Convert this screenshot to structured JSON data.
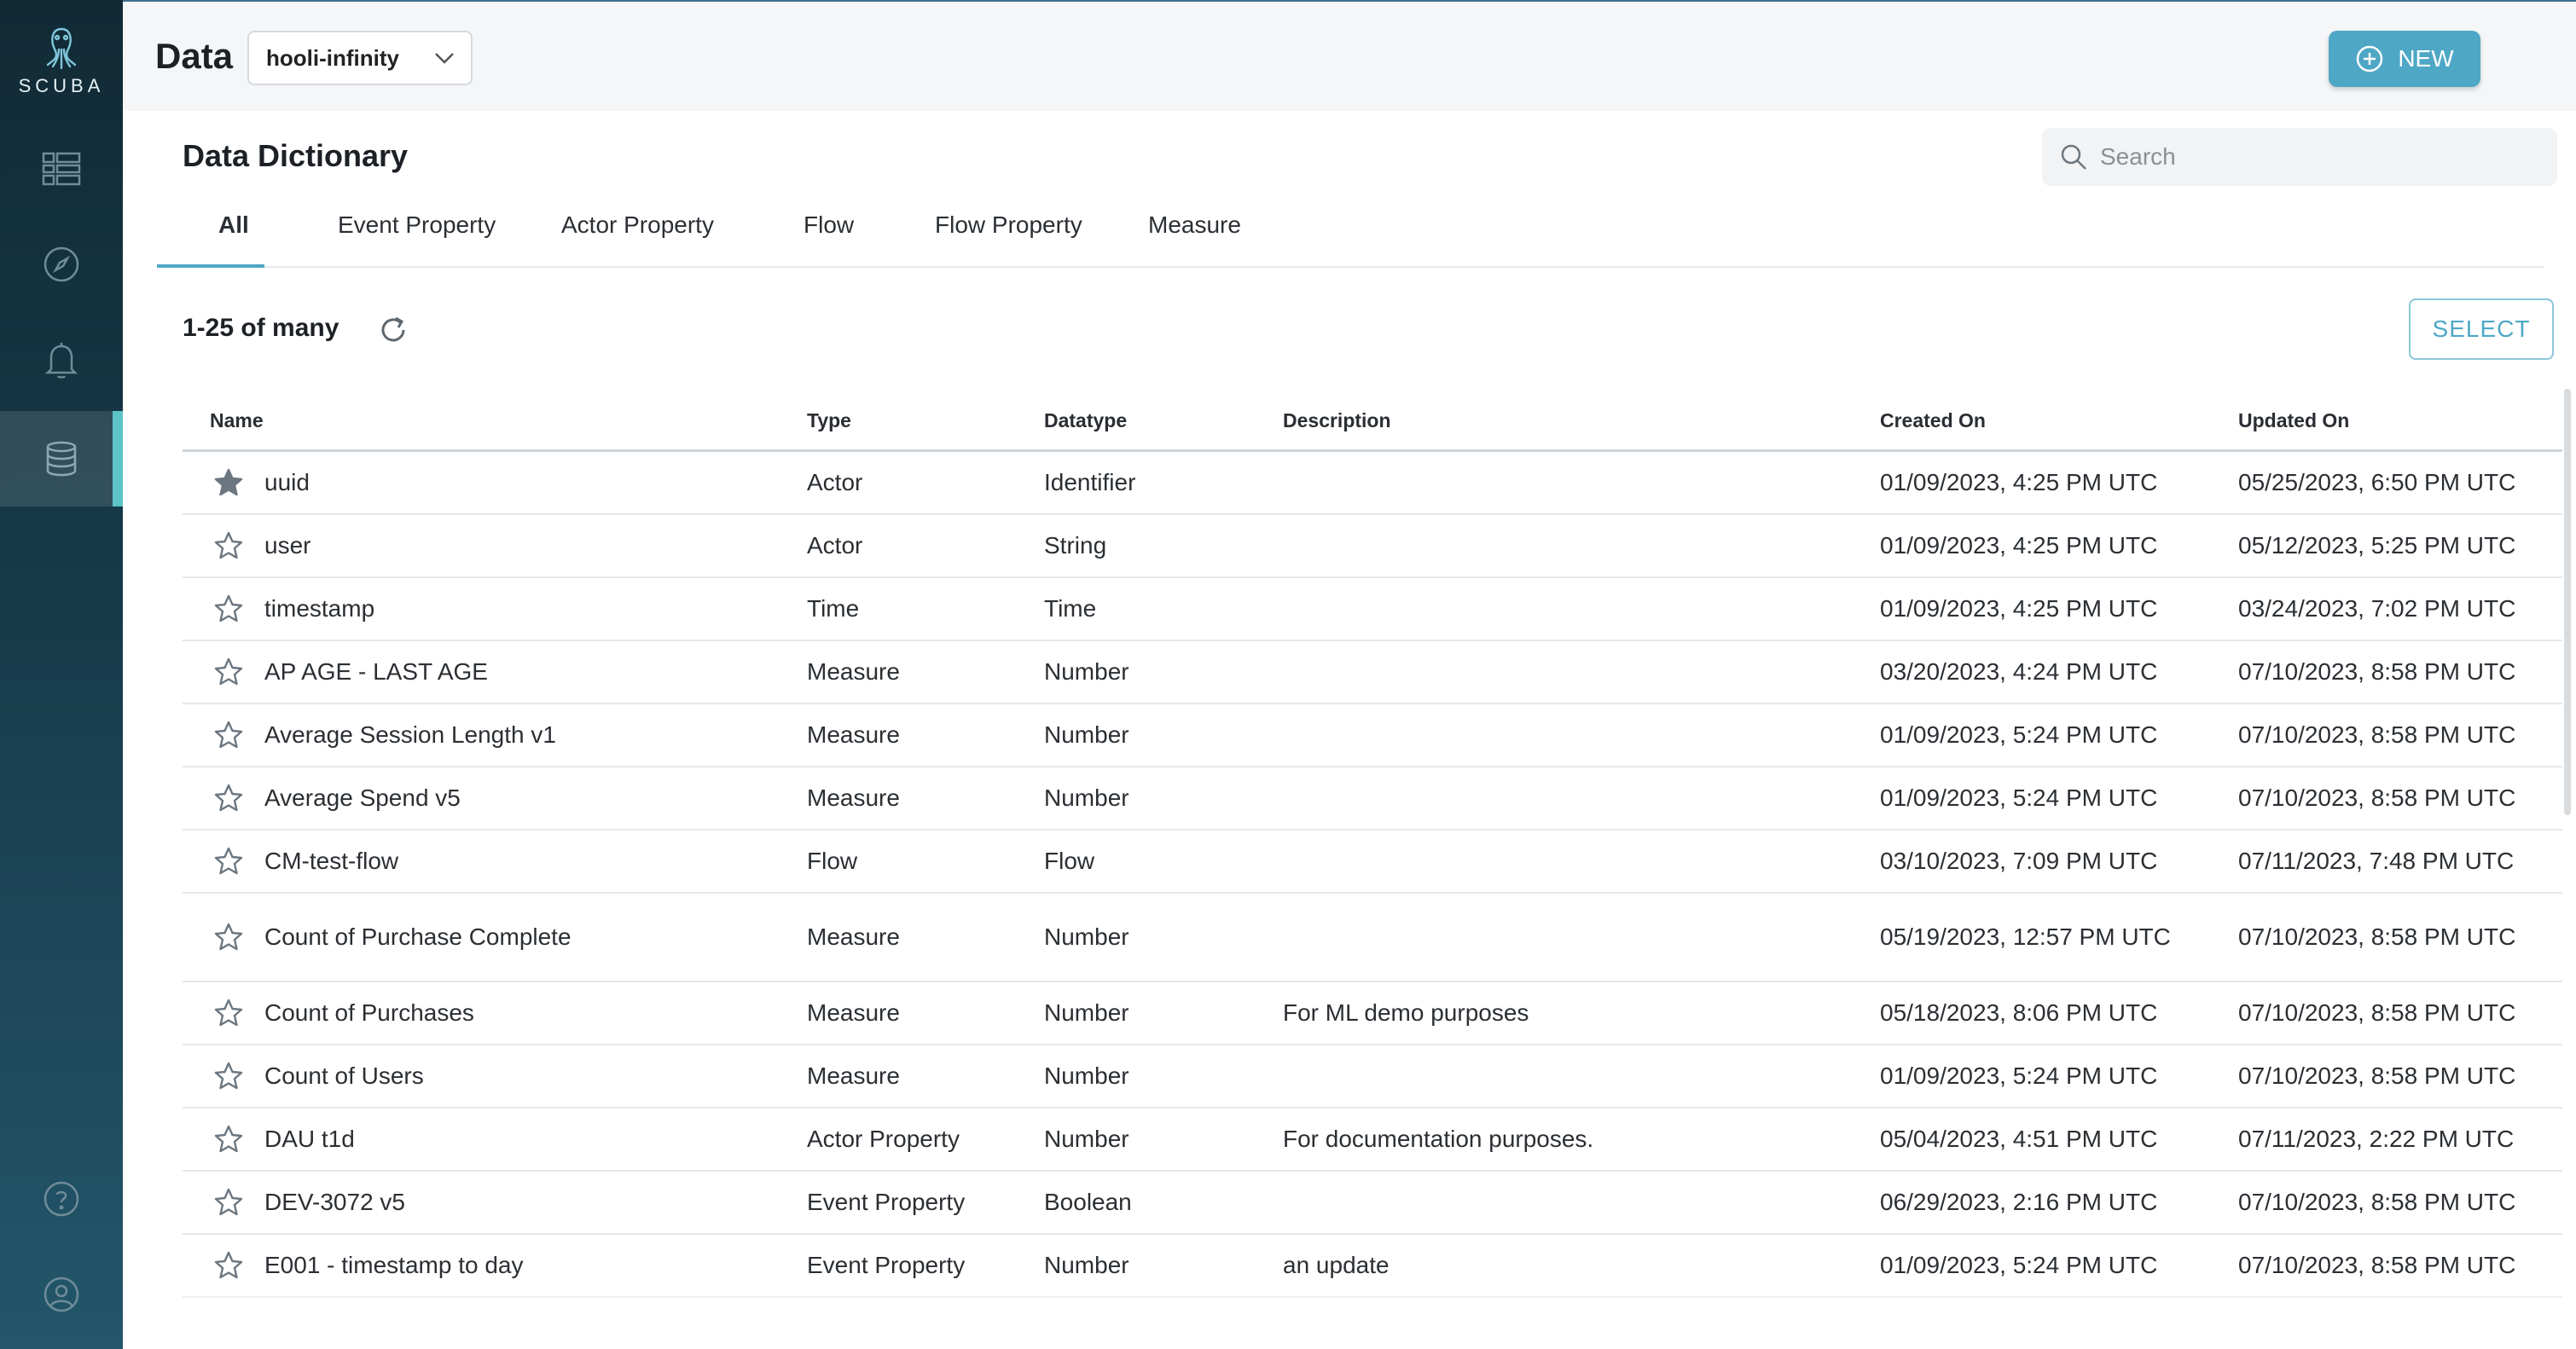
{
  "app": {
    "brand": "SCUBA"
  },
  "header": {
    "title": "Data",
    "dataset": "hooli-infinity",
    "new_label": "NEW"
  },
  "sidebar": {
    "items": [
      {
        "icon": "dashboard-grid-icon"
      },
      {
        "icon": "compass-icon"
      },
      {
        "icon": "bell-icon"
      },
      {
        "icon": "database-icon",
        "active": true
      },
      {
        "icon": "help-icon"
      },
      {
        "icon": "user-account-icon"
      }
    ]
  },
  "main": {
    "section_title": "Data Dictionary",
    "search_placeholder": "Search",
    "tabs": [
      "All",
      "Event Property",
      "Actor Property",
      "Flow",
      "Flow Property",
      "Measure"
    ],
    "active_tab": "All",
    "count_label": "1-25 of many",
    "select_label": "SELECT"
  },
  "table": {
    "columns": [
      "Name",
      "Type",
      "Datatype",
      "Description",
      "Created On",
      "Updated On"
    ],
    "rows": [
      {
        "starred": true,
        "name": "uuid",
        "type": "Actor",
        "datatype": "Identifier",
        "description": "",
        "created": "01/09/2023, 4:25 PM UTC",
        "updated": "05/25/2023, 6:50 PM UTC"
      },
      {
        "starred": false,
        "name": "user",
        "type": "Actor",
        "datatype": "String",
        "description": "",
        "created": "01/09/2023, 4:25 PM UTC",
        "updated": "05/12/2023, 5:25 PM UTC"
      },
      {
        "starred": false,
        "name": "timestamp",
        "type": "Time",
        "datatype": "Time",
        "description": "",
        "created": "01/09/2023, 4:25 PM UTC",
        "updated": "03/24/2023, 7:02 PM UTC"
      },
      {
        "starred": false,
        "name": "AP AGE - LAST AGE",
        "type": "Measure",
        "datatype": "Number",
        "description": "",
        "created": "03/20/2023, 4:24 PM UTC",
        "updated": "07/10/2023, 8:58 PM UTC"
      },
      {
        "starred": false,
        "name": "Average Session Length v1",
        "type": "Measure",
        "datatype": "Number",
        "description": "",
        "created": "01/09/2023, 5:24 PM UTC",
        "updated": "07/10/2023, 8:58 PM UTC"
      },
      {
        "starred": false,
        "name": "Average Spend v5",
        "type": "Measure",
        "datatype": "Number",
        "description": "",
        "created": "01/09/2023, 5:24 PM UTC",
        "updated": "07/10/2023, 8:58 PM UTC"
      },
      {
        "starred": false,
        "name": "CM-test-flow",
        "type": "Flow",
        "datatype": "Flow",
        "description": "",
        "created": "03/10/2023, 7:09 PM UTC",
        "updated": "07/11/2023, 7:48 PM UTC"
      },
      {
        "starred": false,
        "name": "Count of Purchase Complete",
        "type": "Measure",
        "datatype": "Number",
        "description": "",
        "created": "05/19/2023, 12:57 PM UTC",
        "updated": "07/10/2023, 8:58 PM UTC"
      },
      {
        "starred": false,
        "name": "Count of Purchases",
        "type": "Measure",
        "datatype": "Number",
        "description": "For ML demo purposes",
        "created": "05/18/2023, 8:06 PM UTC",
        "updated": "07/10/2023, 8:58 PM UTC"
      },
      {
        "starred": false,
        "name": "Count of Users",
        "type": "Measure",
        "datatype": "Number",
        "description": "",
        "created": "01/09/2023, 5:24 PM UTC",
        "updated": "07/10/2023, 8:58 PM UTC"
      },
      {
        "starred": false,
        "name": "DAU t1d",
        "type": "Actor Property",
        "datatype": "Number",
        "description": "For documentation purposes.",
        "created": "05/04/2023, 4:51 PM UTC",
        "updated": "07/11/2023, 2:22 PM UTC"
      },
      {
        "starred": false,
        "name": "DEV-3072 v5",
        "type": "Event Property",
        "datatype": "Boolean",
        "description": "",
        "created": "06/29/2023, 2:16 PM UTC",
        "updated": "07/10/2023, 8:58 PM UTC"
      },
      {
        "starred": false,
        "name": "E001 - timestamp to day",
        "type": "Event Property",
        "datatype": "Number",
        "description": "an update",
        "created": "01/09/2023, 5:24 PM UTC",
        "updated": "07/10/2023, 8:58 PM UTC"
      }
    ]
  },
  "colors": {
    "accent": "#4fa7c6",
    "sidebar_dark": "#112a36",
    "sidebar_active_marker": "#5cc4c9"
  }
}
